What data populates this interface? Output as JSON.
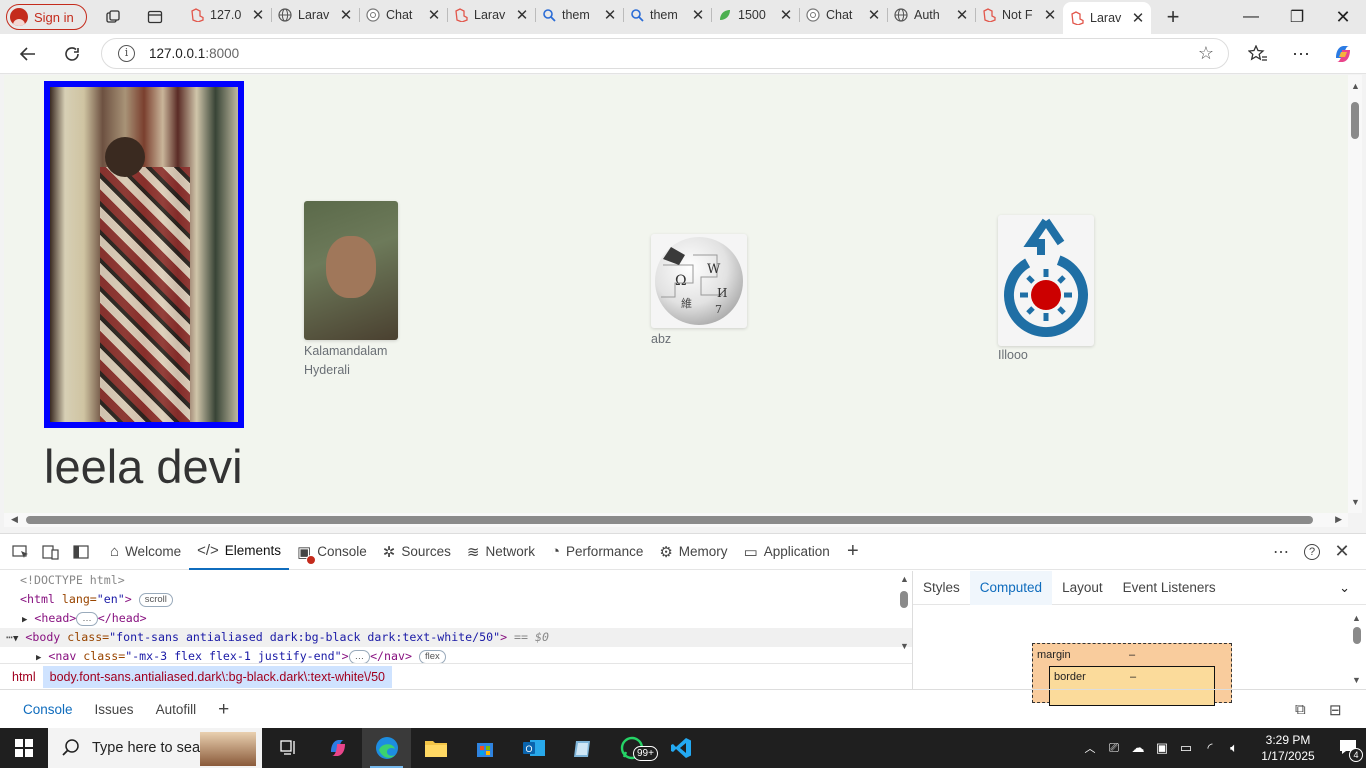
{
  "browser": {
    "signin_label": "Sign in",
    "tabs": [
      {
        "label": "127.0",
        "icon": "laravel-icon"
      },
      {
        "label": "Larav",
        "icon": "globe-icon"
      },
      {
        "label": "Chat",
        "icon": "chatgpt-icon"
      },
      {
        "label": "Larav",
        "icon": "laravel-icon"
      },
      {
        "label": "them",
        "icon": "search-icon"
      },
      {
        "label": "them",
        "icon": "search-icon"
      },
      {
        "label": "1500",
        "icon": "leaf-icon"
      },
      {
        "label": "Chat",
        "icon": "chatgpt-icon"
      },
      {
        "label": "Auth",
        "icon": "globe-icon"
      },
      {
        "label": "Not F",
        "icon": "laravel-icon"
      },
      {
        "label": "Larav",
        "icon": "laravel-icon",
        "active": true
      }
    ],
    "url": "127.0.0.1",
    "url_port": ":8000"
  },
  "page": {
    "main_title": "leela devi",
    "cards": [
      {
        "caption": "Kalamandalam",
        "caption2": "Hyderali"
      },
      {
        "caption": "abz"
      },
      {
        "caption": "Illooo"
      }
    ]
  },
  "devtools": {
    "tabs": [
      "Welcome",
      "Elements",
      "Console",
      "Sources",
      "Network",
      "Performance",
      "Memory",
      "Application"
    ],
    "active_tab": "Elements",
    "dom": {
      "doctype": "<!DOCTYPE html>",
      "html_open": "<html",
      "html_attr": " lang=",
      "html_val": "\"en\"",
      "html_close": ">",
      "scroll_pill": "scroll",
      "head_open": "<head>",
      "head_close": "</head>",
      "body_open": "<body",
      "body_attr": " class=",
      "body_val": "\"font-sans antialiased dark:bg-black dark:text-white/50\"",
      "body_close": ">",
      "body_marker": "== $0",
      "nav_open": "<nav",
      "nav_attr": " class=",
      "nav_val": "\"-mx-3 flex flex-1 justify-end\"",
      "nav_close": ">",
      "nav_end": "</nav>",
      "flex_pill": "flex",
      "ellipsis": "…"
    },
    "breadcrumbs": [
      "html",
      "body.font-sans.antialiased.dark\\:bg-black.dark\\:text-white\\/50"
    ],
    "side_tabs": [
      "Styles",
      "Computed",
      "Layout",
      "Event Listeners"
    ],
    "side_active": "Computed",
    "boxmodel": {
      "margin_label": "margin",
      "margin_value": "–",
      "border_label": "border",
      "border_value": "–"
    },
    "drawer_tabs": [
      "Console",
      "Issues",
      "Autofill"
    ]
  },
  "taskbar": {
    "search_placeholder": "Type here to search",
    "whatsapp_badge": "99+",
    "time": "3:29 PM",
    "date": "1/17/2025",
    "notifications": "4"
  }
}
